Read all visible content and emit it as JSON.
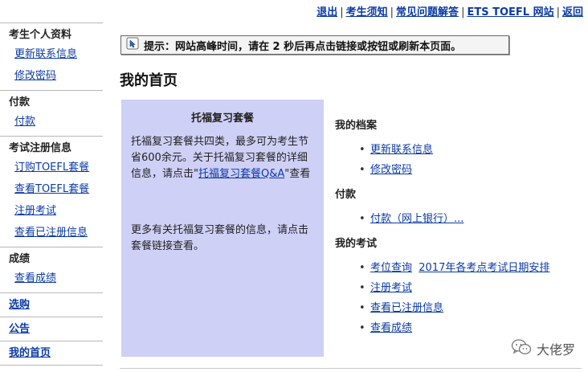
{
  "topnav": [
    {
      "label": "退出"
    },
    {
      "label": "考生须知"
    },
    {
      "label": "常见问题解答"
    },
    {
      "label": "ETS TOEFL 网站"
    },
    {
      "label": "返回"
    }
  ],
  "topnav_separators": [
    "|",
    "|",
    "|",
    "|"
  ],
  "sidebar": {
    "sections": [
      {
        "heading": "考生个人资料",
        "items": [
          "更新联系信息",
          "修改密码"
        ]
      },
      {
        "heading": "付款",
        "items": [
          "付款"
        ]
      },
      {
        "heading": "考试注册信息",
        "items": [
          "订购TOEFL套餐",
          "查看TOEFL套餐",
          "注册考试",
          "查看已注册信息"
        ]
      },
      {
        "heading": "成绩",
        "items": [
          "查看成绩"
        ]
      }
    ],
    "links": [
      "选购",
      "公告",
      "我的首页"
    ]
  },
  "notice": {
    "icon": "info-mouse-icon",
    "text": "提示：网站高峰时间，请在 2 秒后再点击链接或按钮或刷新本页面。"
  },
  "page_title": "我的首页",
  "package": {
    "title": "托福复习套餐",
    "p1_before": "托福复习套餐共四类，最多可为考生节省600余元。关于托福复习套餐的详细信息，请点击\"",
    "p1_link": "托福复习套餐Q&A",
    "p1_after": "\"查看",
    "p2": "更多有关托福复习套餐的信息，请点击套餐链接查看。"
  },
  "right": {
    "profile_heading": "我的档案",
    "profile_items": [
      "更新联系信息",
      "修改密码"
    ],
    "payment_heading": "付款",
    "payment_items": [
      "付款（网上银行）..."
    ],
    "exam_heading": "我的考试",
    "exam_seat_query": "考位查询",
    "exam_schedule": "2017年各考点考试日期安排",
    "exam_items": [
      "注册考试",
      "查看已注册信息",
      "查看成绩"
    ],
    "bullet": "•"
  },
  "watermark": {
    "text": "大佬罗",
    "icon": "wechat-icon"
  },
  "colors": {
    "link": "#0b3aa5",
    "package_bg": "#cfd0f6",
    "notice_bg": "#f4f4f4"
  }
}
